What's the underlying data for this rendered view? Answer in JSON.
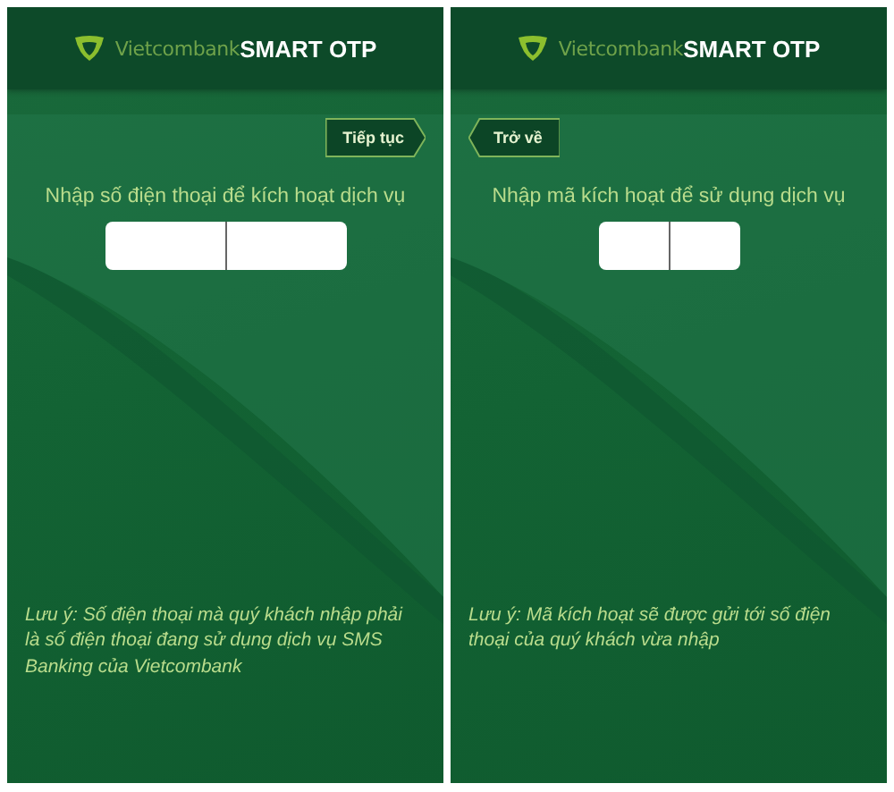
{
  "screens": [
    {
      "logo": {
        "brand": "Vietcombank",
        "product": "SMART OTP"
      },
      "nav_button": {
        "kind": "next",
        "label": "Tiếp tục"
      },
      "prompt": "Nhập số điện thoại để kích hoạt dịch vụ",
      "field": {
        "kind": "phone"
      },
      "note": "Lưu ý: Số điện thoại mà quý khách nhập phải là số điện thoại đang sử dụng dịch vụ SMS Banking của Vietcombank"
    },
    {
      "logo": {
        "brand": "Vietcombank",
        "product": "SMART OTP"
      },
      "nav_button": {
        "kind": "back",
        "label": "Trở về"
      },
      "prompt": "Nhập mã kích hoạt để sử dụng dịch vụ",
      "field": {
        "kind": "code"
      },
      "note": "Lưu ý: Mã kích hoạt sẽ được gửi tới số điện thoại của quý khách vừa nhập"
    }
  ]
}
